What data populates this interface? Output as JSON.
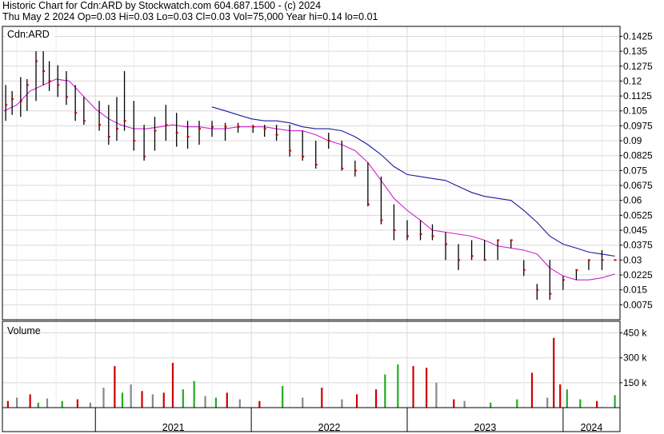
{
  "header": {
    "line1": "Historic Chart for Cdn:ARD by Stockwatch.com 604.687.1500 - (c) 2024",
    "line2": "Thu May  2 2024  Op=0.03  Hi=0.03  Lo=0.03  Cl=0.03  Vol=75,000  Year hi=0.14  lo=0.01"
  },
  "price_panel": {
    "label": "Cdn:ARD"
  },
  "volume_panel": {
    "label": "Volume"
  },
  "chart_data": {
    "type": "line",
    "price_axis": {
      "ticks": [
        0.0075,
        0.015,
        0.0225,
        0.03,
        0.0375,
        0.045,
        0.0525,
        0.06,
        0.0675,
        0.075,
        0.0825,
        0.09,
        0.0975,
        0.105,
        0.1125,
        0.12,
        0.1275,
        0.135,
        0.1425
      ],
      "tick_labels": [
        "0.0075",
        "0.015",
        "0.0225",
        "0.03",
        "0.0375",
        "0.045",
        "0.0525",
        "0.06",
        "0.0675",
        "0.075",
        "0.0825",
        "0.09",
        "0.0975",
        "0.105",
        "0.1125",
        "0.12",
        "0.1275",
        "0.135",
        "0.1425"
      ],
      "ylim": [
        0.0,
        0.1475
      ]
    },
    "volume_axis": {
      "ticks": [
        150000,
        300000,
        450000
      ],
      "tick_labels": [
        "150 k",
        "300 k",
        "450 k"
      ],
      "ylim": [
        0,
        520000
      ]
    },
    "x_axis": {
      "range": [
        "2020-06-01",
        "2024-05-02"
      ],
      "year_labels": [
        {
          "label": "2021",
          "start": "2021-01-01"
        },
        {
          "label": "2022",
          "start": "2022-01-01"
        },
        {
          "label": "2023",
          "start": "2023-01-01"
        },
        {
          "label": "2024",
          "start": "2024-01-01"
        }
      ]
    },
    "grid": true,
    "colors": {
      "up": "#cc0000",
      "down": "#000000",
      "close_dot": "#cc0000",
      "ma_long": "#1a1aa0",
      "ma_short": "#d020d0",
      "vol_up": "#22aa22",
      "vol_down": "#cc0000",
      "vol_flat": "#888888",
      "grid": "#d8d8d8"
    },
    "series": [
      {
        "values": [
          [
            "2021-10-01",
            0.107
          ],
          [
            "2021-11-01",
            0.105
          ],
          [
            "2021-12-01",
            0.103
          ],
          [
            "2022-01-01",
            0.101
          ],
          [
            "2022-02-01",
            0.1
          ],
          [
            "2022-03-01",
            0.1
          ],
          [
            "2022-04-01",
            0.099
          ],
          [
            "2022-05-01",
            0.097
          ],
          [
            "2022-06-01",
            0.096
          ],
          [
            "2022-07-01",
            0.096
          ],
          [
            "2022-08-01",
            0.095
          ],
          [
            "2022-09-01",
            0.092
          ],
          [
            "2022-10-01",
            0.088
          ],
          [
            "2022-11-01",
            0.083
          ],
          [
            "2022-12-01",
            0.077
          ],
          [
            "2023-01-01",
            0.073
          ],
          [
            "2023-02-01",
            0.072
          ],
          [
            "2023-03-01",
            0.071
          ],
          [
            "2023-04-01",
            0.07
          ],
          [
            "2023-05-01",
            0.067
          ],
          [
            "2023-06-01",
            0.064
          ],
          [
            "2023-07-01",
            0.062
          ],
          [
            "2023-08-01",
            0.061
          ],
          [
            "2023-09-01",
            0.06
          ],
          [
            "2023-10-01",
            0.055
          ],
          [
            "2023-11-01",
            0.049
          ],
          [
            "2023-12-01",
            0.042
          ],
          [
            "2024-01-01",
            0.038
          ],
          [
            "2024-02-01",
            0.036
          ],
          [
            "2024-03-01",
            0.034
          ],
          [
            "2024-04-01",
            0.033
          ],
          [
            "2024-05-01",
            0.032
          ]
        ]
      },
      {
        "values": [
          [
            "2020-06-01",
            0.105
          ],
          [
            "2020-07-01",
            0.108
          ],
          [
            "2020-08-01",
            0.115
          ],
          [
            "2020-09-01",
            0.118
          ],
          [
            "2020-10-01",
            0.121
          ],
          [
            "2020-11-01",
            0.12
          ],
          [
            "2020-12-01",
            0.113
          ],
          [
            "2021-01-01",
            0.106
          ],
          [
            "2021-02-01",
            0.101
          ],
          [
            "2021-03-01",
            0.098
          ],
          [
            "2021-04-01",
            0.096
          ],
          [
            "2021-05-01",
            0.096
          ],
          [
            "2021-06-01",
            0.097
          ],
          [
            "2021-07-01",
            0.098
          ],
          [
            "2021-08-01",
            0.097
          ],
          [
            "2021-09-01",
            0.097
          ],
          [
            "2021-10-01",
            0.096
          ],
          [
            "2021-11-01",
            0.096
          ],
          [
            "2021-12-01",
            0.097
          ],
          [
            "2022-01-01",
            0.097
          ],
          [
            "2022-02-01",
            0.097
          ],
          [
            "2022-03-01",
            0.096
          ],
          [
            "2022-04-01",
            0.095
          ],
          [
            "2022-05-01",
            0.095
          ],
          [
            "2022-06-01",
            0.093
          ],
          [
            "2022-07-01",
            0.09
          ],
          [
            "2022-08-01",
            0.088
          ],
          [
            "2022-09-01",
            0.085
          ],
          [
            "2022-10-01",
            0.079
          ],
          [
            "2022-11-01",
            0.07
          ],
          [
            "2022-12-01",
            0.061
          ],
          [
            "2023-01-01",
            0.055
          ],
          [
            "2023-02-01",
            0.05
          ],
          [
            "2023-03-01",
            0.045
          ],
          [
            "2023-04-01",
            0.044
          ],
          [
            "2023-05-01",
            0.043
          ],
          [
            "2023-06-01",
            0.042
          ],
          [
            "2023-07-01",
            0.04
          ],
          [
            "2023-08-01",
            0.037
          ],
          [
            "2023-09-01",
            0.036
          ],
          [
            "2023-10-01",
            0.035
          ],
          [
            "2023-11-01",
            0.033
          ],
          [
            "2023-12-01",
            0.026
          ],
          [
            "2024-01-01",
            0.022
          ],
          [
            "2024-02-01",
            0.02
          ],
          [
            "2024-03-01",
            0.02
          ],
          [
            "2024-04-01",
            0.021
          ],
          [
            "2024-05-01",
            0.023
          ]
        ]
      }
    ],
    "price_bars": [
      {
        "date": "2020-06-05",
        "high": 0.118,
        "low": 0.1,
        "close": 0.108
      },
      {
        "date": "2020-06-20",
        "high": 0.115,
        "low": 0.103,
        "close": 0.111
      },
      {
        "date": "2020-07-10",
        "high": 0.122,
        "low": 0.102,
        "close": 0.11
      },
      {
        "date": "2020-07-25",
        "high": 0.121,
        "low": 0.105,
        "close": 0.118
      },
      {
        "date": "2020-08-15",
        "high": 0.135,
        "low": 0.11,
        "close": 0.13
      },
      {
        "date": "2020-09-01",
        "high": 0.135,
        "low": 0.118,
        "close": 0.125
      },
      {
        "date": "2020-09-15",
        "high": 0.13,
        "low": 0.115,
        "close": 0.12
      },
      {
        "date": "2020-10-05",
        "high": 0.128,
        "low": 0.112,
        "close": 0.118
      },
      {
        "date": "2020-10-25",
        "high": 0.125,
        "low": 0.108,
        "close": 0.112
      },
      {
        "date": "2020-11-15",
        "high": 0.118,
        "low": 0.1,
        "close": 0.104
      },
      {
        "date": "2020-12-05",
        "high": 0.112,
        "low": 0.098,
        "close": 0.1
      },
      {
        "date": "2021-01-10",
        "high": 0.11,
        "low": 0.095,
        "close": 0.098
      },
      {
        "date": "2021-02-01",
        "high": 0.108,
        "low": 0.088,
        "close": 0.092
      },
      {
        "date": "2021-02-20",
        "high": 0.112,
        "low": 0.09,
        "close": 0.096
      },
      {
        "date": "2021-03-10",
        "high": 0.125,
        "low": 0.095,
        "close": 0.1
      },
      {
        "date": "2021-04-01",
        "high": 0.11,
        "low": 0.085,
        "close": 0.09
      },
      {
        "date": "2021-04-25",
        "high": 0.098,
        "low": 0.08,
        "close": 0.082
      },
      {
        "date": "2021-05-20",
        "high": 0.102,
        "low": 0.085,
        "close": 0.095
      },
      {
        "date": "2021-06-15",
        "high": 0.108,
        "low": 0.09,
        "close": 0.098
      },
      {
        "date": "2021-07-10",
        "high": 0.104,
        "low": 0.087,
        "close": 0.094
      },
      {
        "date": "2021-08-05",
        "high": 0.1,
        "low": 0.086,
        "close": 0.092
      },
      {
        "date": "2021-09-01",
        "high": 0.1,
        "low": 0.088,
        "close": 0.096
      },
      {
        "date": "2021-10-01",
        "high": 0.1,
        "low": 0.092,
        "close": 0.097
      },
      {
        "date": "2021-11-01",
        "high": 0.099,
        "low": 0.09,
        "close": 0.097
      },
      {
        "date": "2021-12-01",
        "high": 0.099,
        "low": 0.094,
        "close": 0.097
      },
      {
        "date": "2022-01-05",
        "high": 0.098,
        "low": 0.094,
        "close": 0.097
      },
      {
        "date": "2022-02-01",
        "high": 0.098,
        "low": 0.092,
        "close": 0.096
      },
      {
        "date": "2022-03-01",
        "high": 0.098,
        "low": 0.09,
        "close": 0.093
      },
      {
        "date": "2022-04-01",
        "high": 0.098,
        "low": 0.082,
        "close": 0.085
      },
      {
        "date": "2022-05-01",
        "high": 0.095,
        "low": 0.08,
        "close": 0.082
      },
      {
        "date": "2022-06-01",
        "high": 0.09,
        "low": 0.076,
        "close": 0.078
      },
      {
        "date": "2022-07-01",
        "high": 0.094,
        "low": 0.086,
        "close": 0.09
      },
      {
        "date": "2022-08-01",
        "high": 0.09,
        "low": 0.075,
        "close": 0.076
      },
      {
        "date": "2022-09-01",
        "high": 0.08,
        "low": 0.072,
        "close": 0.075
      },
      {
        "date": "2022-10-01",
        "high": 0.079,
        "low": 0.057,
        "close": 0.058
      },
      {
        "date": "2022-11-01",
        "high": 0.072,
        "low": 0.048,
        "close": 0.05
      },
      {
        "date": "2022-12-01",
        "high": 0.058,
        "low": 0.04,
        "close": 0.045
      },
      {
        "date": "2023-01-01",
        "high": 0.05,
        "low": 0.04,
        "close": 0.042
      },
      {
        "date": "2023-02-01",
        "high": 0.05,
        "low": 0.04,
        "close": 0.043
      },
      {
        "date": "2023-03-01",
        "high": 0.048,
        "low": 0.04,
        "close": 0.042
      },
      {
        "date": "2023-04-01",
        "high": 0.044,
        "low": 0.03,
        "close": 0.038
      },
      {
        "date": "2023-05-01",
        "high": 0.038,
        "low": 0.025,
        "close": 0.03
      },
      {
        "date": "2023-06-01",
        "high": 0.04,
        "low": 0.03,
        "close": 0.032
      },
      {
        "date": "2023-07-01",
        "high": 0.04,
        "low": 0.03,
        "close": 0.03
      },
      {
        "date": "2023-08-01",
        "high": 0.04,
        "low": 0.03,
        "close": 0.04
      },
      {
        "date": "2023-09-01",
        "high": 0.04,
        "low": 0.036,
        "close": 0.04
      },
      {
        "date": "2023-10-01",
        "high": 0.03,
        "low": 0.022,
        "close": 0.025
      },
      {
        "date": "2023-11-01",
        "high": 0.018,
        "low": 0.01,
        "close": 0.015
      },
      {
        "date": "2023-12-01",
        "high": 0.03,
        "low": 0.01,
        "close": 0.013
      },
      {
        "date": "2024-01-01",
        "high": 0.022,
        "low": 0.015,
        "close": 0.02
      },
      {
        "date": "2024-02-01",
        "high": 0.025,
        "low": 0.02,
        "close": 0.025
      },
      {
        "date": "2024-03-01",
        "high": 0.03,
        "low": 0.025,
        "close": 0.03
      },
      {
        "date": "2024-04-01",
        "high": 0.035,
        "low": 0.025,
        "close": 0.03
      },
      {
        "date": "2024-05-01",
        "high": 0.03,
        "low": 0.03,
        "close": 0.03
      }
    ],
    "volume_bars": [
      {
        "date": "2020-06-10",
        "volume": 40000,
        "dir": "down"
      },
      {
        "date": "2020-07-01",
        "volume": 60000,
        "dir": "flat"
      },
      {
        "date": "2020-08-01",
        "volume": 80000,
        "dir": "down"
      },
      {
        "date": "2020-08-20",
        "volume": 30000,
        "dir": "up"
      },
      {
        "date": "2020-09-10",
        "volume": 55000,
        "dir": "flat"
      },
      {
        "date": "2020-10-15",
        "volume": 40000,
        "dir": "up"
      },
      {
        "date": "2020-11-20",
        "volume": 50000,
        "dir": "down"
      },
      {
        "date": "2020-12-20",
        "volume": 30000,
        "dir": "flat"
      },
      {
        "date": "2021-01-20",
        "volume": 120000,
        "dir": "flat"
      },
      {
        "date": "2021-02-15",
        "volume": 250000,
        "dir": "down"
      },
      {
        "date": "2021-03-05",
        "volume": 90000,
        "dir": "up"
      },
      {
        "date": "2021-03-25",
        "volume": 140000,
        "dir": "flat"
      },
      {
        "date": "2021-04-20",
        "volume": 100000,
        "dir": "down"
      },
      {
        "date": "2021-05-15",
        "volume": 80000,
        "dir": "flat"
      },
      {
        "date": "2021-06-10",
        "volume": 90000,
        "dir": "down"
      },
      {
        "date": "2021-07-01",
        "volume": 270000,
        "dir": "down"
      },
      {
        "date": "2021-07-25",
        "volume": 110000,
        "dir": "up"
      },
      {
        "date": "2021-08-20",
        "volume": 160000,
        "dir": "up"
      },
      {
        "date": "2021-09-15",
        "volume": 70000,
        "dir": "flat"
      },
      {
        "date": "2021-10-10",
        "volume": 60000,
        "dir": "up"
      },
      {
        "date": "2021-11-05",
        "volume": 90000,
        "dir": "down"
      },
      {
        "date": "2021-12-05",
        "volume": 50000,
        "dir": "flat"
      },
      {
        "date": "2022-01-20",
        "volume": 40000,
        "dir": "down"
      },
      {
        "date": "2022-03-15",
        "volume": 130000,
        "dir": "up"
      },
      {
        "date": "2022-05-01",
        "volume": 60000,
        "dir": "flat"
      },
      {
        "date": "2022-06-15",
        "volume": 120000,
        "dir": "down"
      },
      {
        "date": "2022-08-01",
        "volume": 50000,
        "dir": "flat"
      },
      {
        "date": "2022-09-05",
        "volume": 80000,
        "dir": "down"
      },
      {
        "date": "2022-10-20",
        "volume": 110000,
        "dir": "down"
      },
      {
        "date": "2022-11-10",
        "volume": 200000,
        "dir": "up"
      },
      {
        "date": "2022-12-10",
        "volume": 260000,
        "dir": "up"
      },
      {
        "date": "2023-01-15",
        "volume": 250000,
        "dir": "down"
      },
      {
        "date": "2023-02-15",
        "volume": 240000,
        "dir": "down"
      },
      {
        "date": "2023-03-10",
        "volume": 150000,
        "dir": "flat"
      },
      {
        "date": "2023-04-20",
        "volume": 50000,
        "dir": "down"
      },
      {
        "date": "2023-05-15",
        "volume": 40000,
        "dir": "flat"
      },
      {
        "date": "2023-07-15",
        "volume": 30000,
        "dir": "up"
      },
      {
        "date": "2023-09-15",
        "volume": 50000,
        "dir": "up"
      },
      {
        "date": "2023-10-20",
        "volume": 210000,
        "dir": "down"
      },
      {
        "date": "2023-11-25",
        "volume": 60000,
        "dir": "flat"
      },
      {
        "date": "2023-12-10",
        "volume": 420000,
        "dir": "down"
      },
      {
        "date": "2023-12-25",
        "volume": 140000,
        "dir": "down"
      },
      {
        "date": "2024-01-10",
        "volume": 110000,
        "dir": "up"
      },
      {
        "date": "2024-02-10",
        "volume": 50000,
        "dir": "up"
      },
      {
        "date": "2024-03-20",
        "volume": 40000,
        "dir": "down"
      },
      {
        "date": "2024-05-01",
        "volume": 75000,
        "dir": "up"
      }
    ]
  }
}
